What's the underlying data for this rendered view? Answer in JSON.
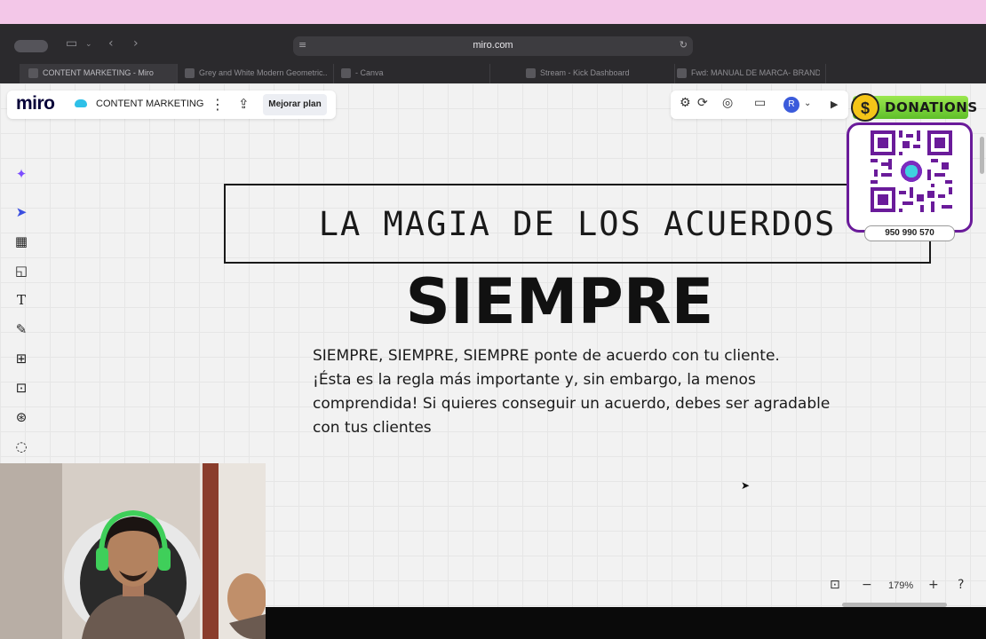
{
  "browser": {
    "url": "miro.com",
    "tabs": [
      {
        "label": "CONTENT MARKETING - Miro",
        "active": true
      },
      {
        "label": "Grey and White Modern Geometric...",
        "active": false
      },
      {
        "label": "- Canva",
        "active": false
      },
      {
        "label": "Stream - Kick Dashboard",
        "active": false
      },
      {
        "label": "Fwd: MANUAL DE MARCA- BRANDI...",
        "active": false
      }
    ]
  },
  "board": {
    "logo": "miro",
    "title": "CONTENT MARKETING",
    "upgrade_label": "Mejorar plan",
    "avatar_initial": "R"
  },
  "content": {
    "frame_title": "LA MAGIA DE LOS ACUERDOS",
    "heading": "SIEMPRE",
    "body_lines": [
      "SIEMPRE, SIEMPRE, SIEMPRE ponte de acuerdo con tu cliente.",
      "¡Ésta es la regla más importante y, sin embargo, la menos",
      "comprendida! Si quieres conseguir un acuerdo, debes ser agradable",
      "con tus clientes"
    ]
  },
  "zoom": {
    "value": "179%"
  },
  "overlay": {
    "donations_label": "DONATIONS",
    "coin_symbol": "$",
    "phone": "950 990 570"
  },
  "colors": {
    "menubar": "#f3c7e8",
    "accent": "#3b4fe0",
    "donation_green": "#7ed957",
    "qr_border": "#6a1b9a"
  }
}
